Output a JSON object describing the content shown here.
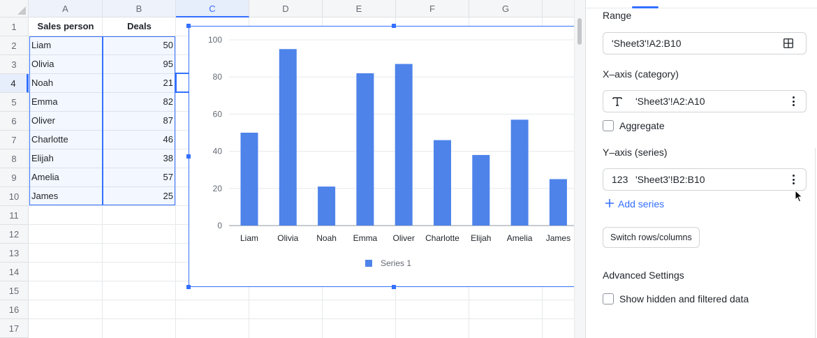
{
  "sheet": {
    "columns": [
      "A",
      "B",
      "C",
      "D",
      "E",
      "F",
      "G"
    ],
    "rows": [
      "1",
      "2",
      "3",
      "4",
      "5",
      "6",
      "7",
      "8",
      "9",
      "10",
      "11",
      "12",
      "13",
      "14",
      "15",
      "16",
      "17"
    ],
    "header": {
      "a": "Sales person",
      "b": "Deals"
    },
    "data": [
      {
        "name": "Liam",
        "deals": "50"
      },
      {
        "name": "Olivia",
        "deals": "95"
      },
      {
        "name": "Noah",
        "deals": "21"
      },
      {
        "name": "Emma",
        "deals": "82"
      },
      {
        "name": "Oliver",
        "deals": "87"
      },
      {
        "name": "Charlotte",
        "deals": "46"
      },
      {
        "name": "Elijah",
        "deals": "38"
      },
      {
        "name": "Amelia",
        "deals": "57"
      },
      {
        "name": "James",
        "deals": "25"
      }
    ]
  },
  "chart_data": {
    "type": "bar",
    "categories": [
      "Liam",
      "Olivia",
      "Noah",
      "Emma",
      "Oliver",
      "Charlotte",
      "Elijah",
      "Amelia",
      "James"
    ],
    "series": [
      {
        "name": "Series 1",
        "values": [
          50,
          95,
          21,
          82,
          87,
          46,
          38,
          57,
          25
        ]
      }
    ],
    "yticks": [
      "0",
      "20",
      "40",
      "60",
      "80",
      "100"
    ],
    "ylim": [
      0,
      100
    ],
    "grid": true,
    "legend": "bottom",
    "color": "#4e83ea"
  },
  "panel": {
    "range_title": "Range",
    "range_value": "'Sheet3'!A2:B10",
    "x_title": "X–axis (category)",
    "x_value": "'Sheet3'!A2:A10",
    "aggregate_label": "Aggregate",
    "y_title": "Y–axis (series)",
    "y_type": "123",
    "y_value": "'Sheet3'!B2:B10",
    "add_series": "Add series",
    "switch_button": "Switch rows/columns",
    "advanced_title": "Advanced Settings",
    "show_hidden_label": "Show hidden and filtered data",
    "accent": "#3370ff"
  }
}
